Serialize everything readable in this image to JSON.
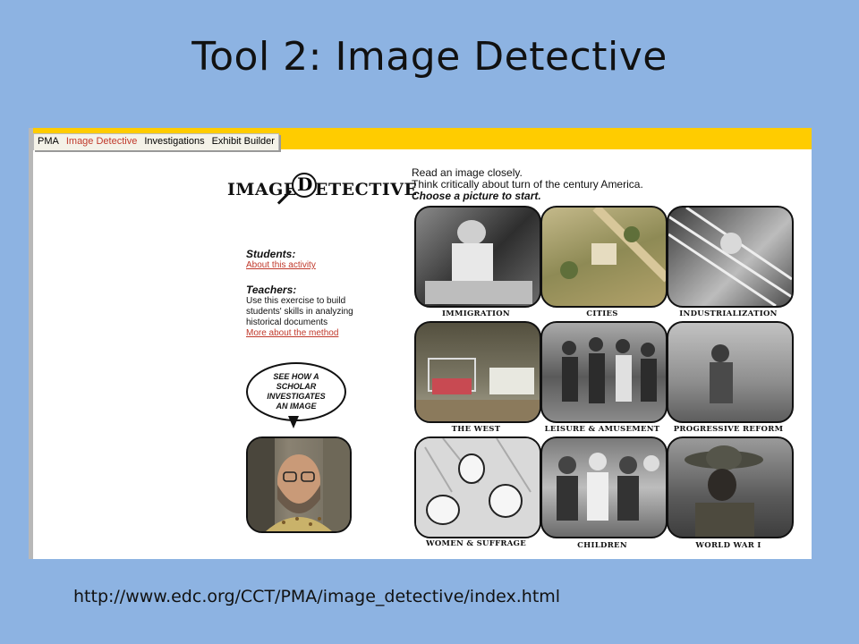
{
  "slide": {
    "title": "Tool 2:  Image Detective",
    "url": "http://www.edc.org/CCT/PMA/image_detective/index.html"
  },
  "nav": {
    "tabs": [
      {
        "label": "PMA",
        "active": false
      },
      {
        "label": "Image Detective",
        "active": true
      },
      {
        "label": "Investigations",
        "active": false
      },
      {
        "label": "Exhibit Builder",
        "active": false
      }
    ]
  },
  "logo": {
    "part1": "IMAGE",
    "letter_d": "D",
    "part2": "ETECTIVE"
  },
  "intro": {
    "line1": "Read an image closely.",
    "line2": "Think critically about turn of the century America.",
    "cta": "Choose a picture to start."
  },
  "sidebar": {
    "students_heading": "Students:",
    "students_link": "About this activity",
    "teachers_heading": "Teachers:",
    "teachers_text": [
      "Use this exercise to build",
      "students' skills in analyzing",
      "historical documents"
    ],
    "teachers_link": "More about the method"
  },
  "bubble": {
    "text": "See how a scholar investigates an image"
  },
  "topics": [
    "IMMIGRATION",
    "CITIES",
    "INDUSTRIALIZATION",
    "THE WEST",
    "LEISURE & AMUSEMENT",
    "PROGRESSIVE REFORM",
    "WOMEN & SUFFRAGE",
    "CHILDREN",
    "WORLD WAR I"
  ],
  "colors": {
    "background": "#8db3e2",
    "nav_bar": "#ffcc00",
    "link": "#c0392b"
  }
}
